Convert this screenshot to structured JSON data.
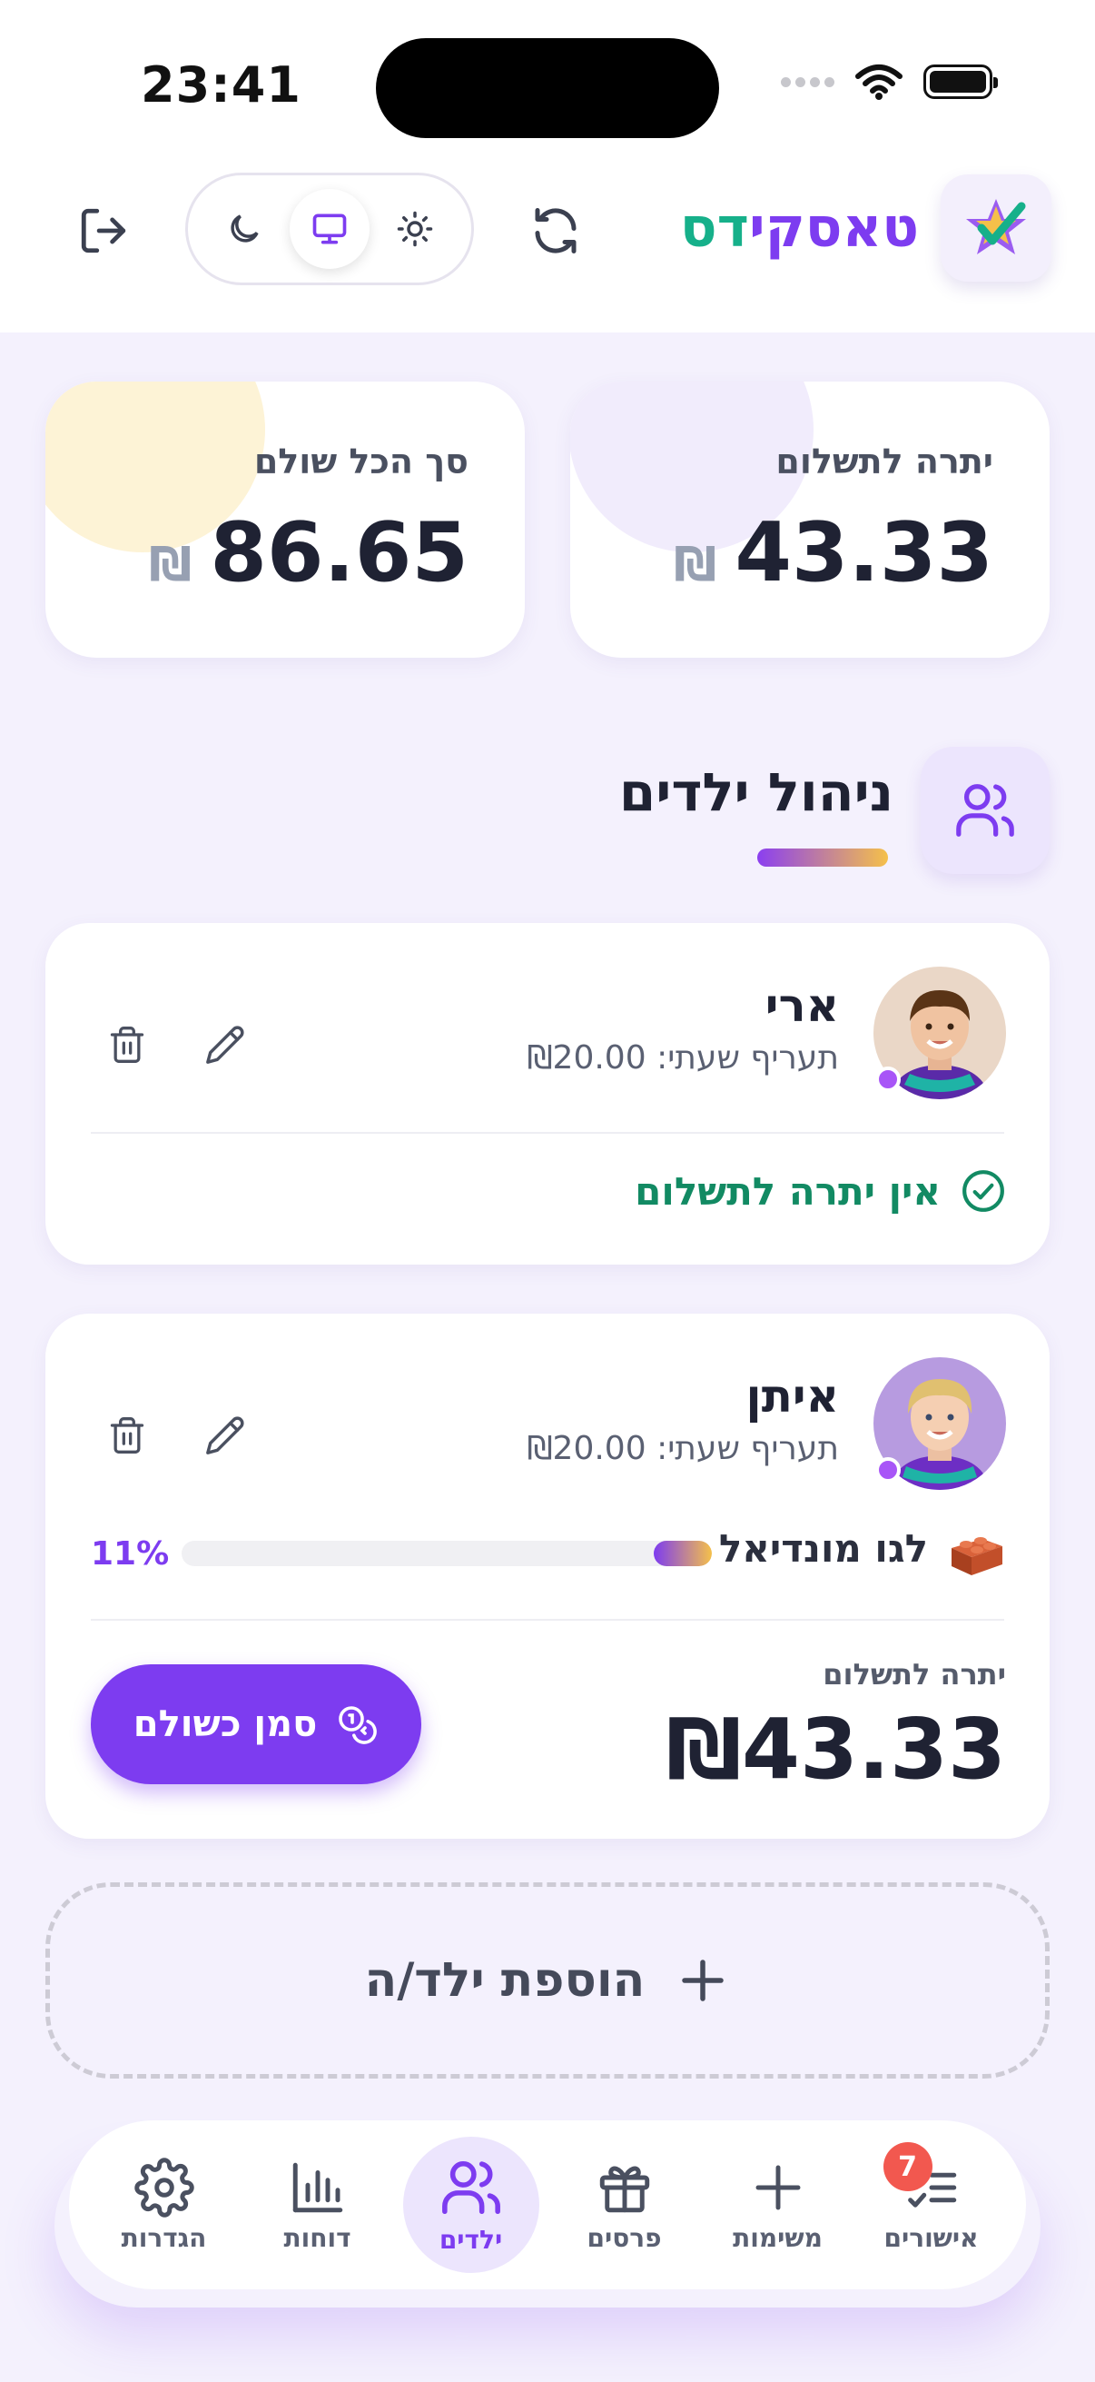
{
  "status_bar": {
    "time": "23:41"
  },
  "header": {
    "brand_part1": "טאסקי",
    "brand_part2": "דס",
    "theme_options": [
      "moon-icon",
      "monitor-icon",
      "sun-icon"
    ],
    "active_theme": "monitor"
  },
  "stats": {
    "balance_label": "יתרה לתשלום",
    "balance_value": "43.33",
    "paid_label": "סך הכל שולם",
    "paid_value": "86.65",
    "currency": "₪"
  },
  "section": {
    "title": "ניהול ילדים"
  },
  "children": [
    {
      "name": "ארי",
      "rate": "תעריף שעתי: ₪20.00",
      "no_balance_text": "אין יתרה לתשלום"
    },
    {
      "name": "איתן",
      "rate": "תעריף שעתי: ₪20.00",
      "goal_label": "לגו מונדיאל",
      "goal_percent_text": "11%",
      "goal_progress": 0.11,
      "balance_label": "יתרה לתשלום",
      "balance_value": "₪43.33",
      "pay_button_label": "סמן כשולם"
    }
  ],
  "add_child_label": "הוספת ילד/ה",
  "nav": {
    "items": [
      {
        "label": "אישורים",
        "icon": "list-check-icon",
        "badge": "7"
      },
      {
        "label": "משימות",
        "icon": "plus-icon"
      },
      {
        "label": "פרסים",
        "icon": "gift-icon"
      },
      {
        "label": "ילדים",
        "icon": "users-icon",
        "active": true
      },
      {
        "label": "דוחות",
        "icon": "bar-chart-icon"
      },
      {
        "label": "הגדרות",
        "icon": "gear-icon"
      }
    ]
  },
  "colors": {
    "accent": "#7d3cf0",
    "success": "#128a63",
    "teal": "#16b08a",
    "badge": "#f2584f"
  }
}
